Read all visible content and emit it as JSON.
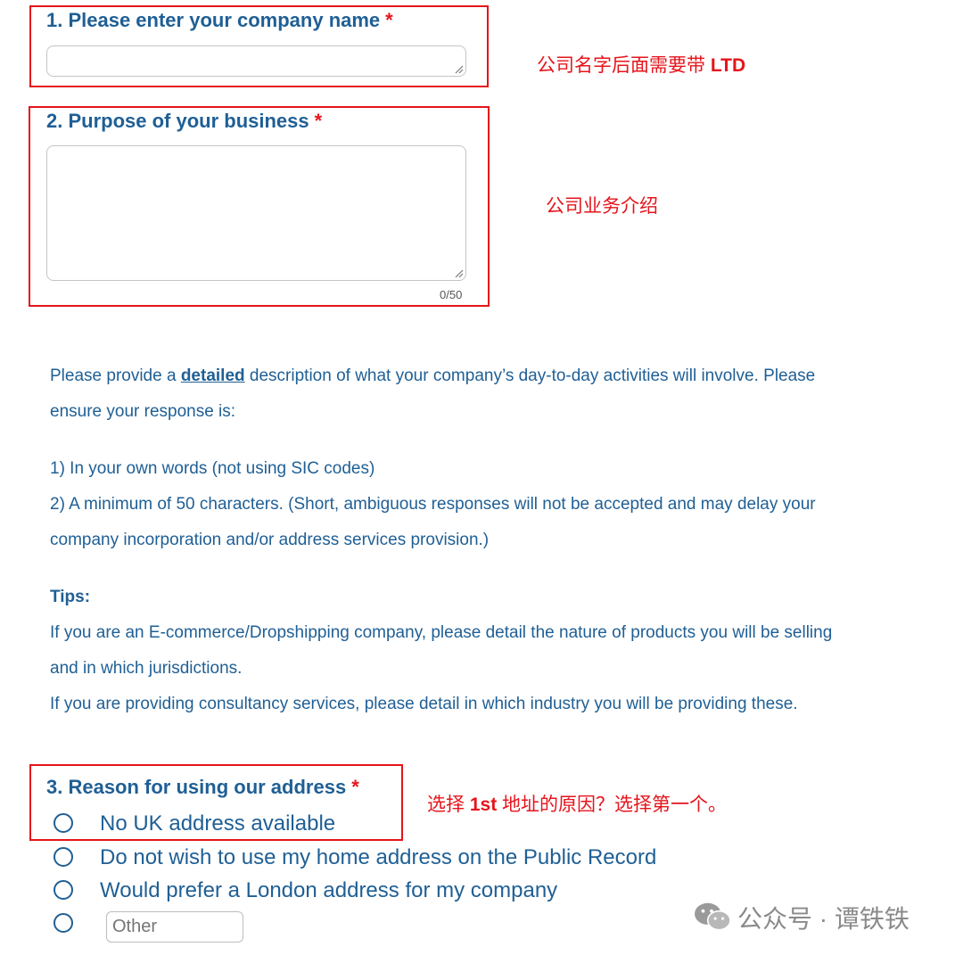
{
  "questions": {
    "q1": {
      "title": "1. Please enter your company name",
      "required_mark": "*",
      "value": ""
    },
    "q2": {
      "title": "2. Purpose of your business",
      "required_mark": "*",
      "value": "",
      "counter": "0/50"
    },
    "q3": {
      "title": "3. Reason for using our address",
      "required_mark": "*",
      "options": [
        "No UK address available",
        "Do not wish to use my home address on the Public Record",
        "Would prefer a London address for my company"
      ],
      "other_placeholder": "Other"
    }
  },
  "annotations": {
    "company_name_note_prefix": "公司名字后面需要带 ",
    "company_name_note_bold": "LTD",
    "business_note": "公司业务介绍",
    "reason_note_prefix": "选择 ",
    "reason_note_bold": "1st",
    "reason_note_suffix": " 地址的原因？选择第一个。"
  },
  "instructions": {
    "line1_prefix": "Please provide a ",
    "line1_emphasis": "detailed",
    "line1_suffix": " description of what your company’s day-to-day activities will involve. Please",
    "line2": "ensure your response is:",
    "rule1": "1) In your own words (not using SIC codes)",
    "rule2_a": "2) A minimum of 50 characters. (Short, ambiguous responses will not be accepted and may delay your",
    "rule2_b": "company incorporation and/or address services provision.)",
    "tips_heading": "Tips:",
    "tip1_a": "If you are an E-commerce/Dropshipping company, please detail the nature of products you will be selling",
    "tip1_b": "and in which jurisdictions.",
    "tip2": "If you are providing consultancy services, please detail in which industry you will be providing these."
  },
  "watermark": {
    "text": "公众号 · 谭铁铁"
  },
  "colors": {
    "accent_blue": "#1f5f95",
    "annotation_red": "#e5141b"
  }
}
